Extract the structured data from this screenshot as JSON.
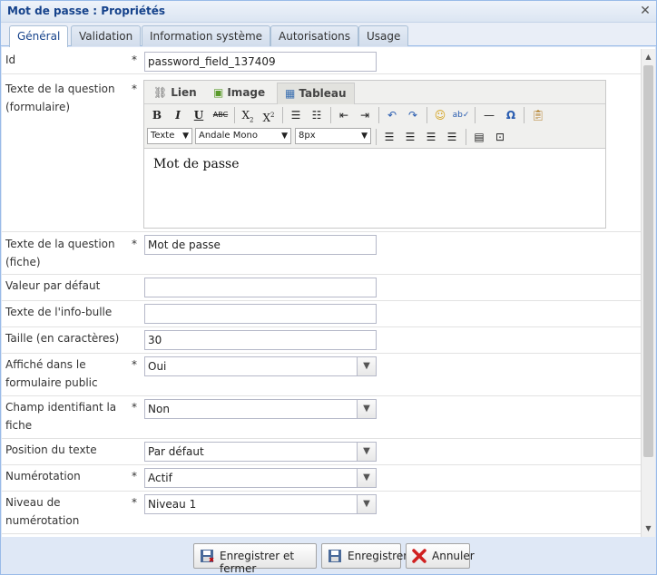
{
  "window": {
    "title": "Mot de passe : Propriétés"
  },
  "tabs": [
    {
      "label": "Général"
    },
    {
      "label": "Validation"
    },
    {
      "label": "Information système"
    },
    {
      "label": "Autorisations"
    },
    {
      "label": "Usage"
    }
  ],
  "form": {
    "id": {
      "label": "Id",
      "required": "*",
      "value": "password_field_137409"
    },
    "question_form": {
      "label": "Texte de la question (formulaire)",
      "required": "*",
      "editor": {
        "tabs": [
          {
            "label": "Lien"
          },
          {
            "label": "Image"
          },
          {
            "label": "Tableau"
          }
        ],
        "format_select": "Texte",
        "font_select": "Andale Mono",
        "size_select": "8px",
        "content": "Mot de passe"
      }
    },
    "question_fiche": {
      "label": "Texte de la question (fiche)",
      "required": "*",
      "value": "Mot de passe"
    },
    "default_value": {
      "label": "Valeur par défaut",
      "value": ""
    },
    "tooltip": {
      "label": "Texte de l'info-bulle",
      "value": ""
    },
    "size": {
      "label": "Taille (en caractères)",
      "value": "30"
    },
    "public_display": {
      "label": "Affiché dans le formulaire public",
      "required": "*",
      "value": "Oui"
    },
    "identifier": {
      "label": "Champ identifiant la fiche",
      "required": "*",
      "value": "Non"
    },
    "text_position": {
      "label": "Position du texte",
      "value": "Par défaut"
    },
    "numbering": {
      "label": "Numérotation",
      "required": "*",
      "value": "Actif"
    },
    "numbering_level": {
      "label": "Niveau de numérotation",
      "required": "*",
      "value": "Niveau 1"
    }
  },
  "footer": {
    "save_close": "Enregistrer et fermer",
    "save": "Enregistrer",
    "cancel": "Annuler"
  }
}
